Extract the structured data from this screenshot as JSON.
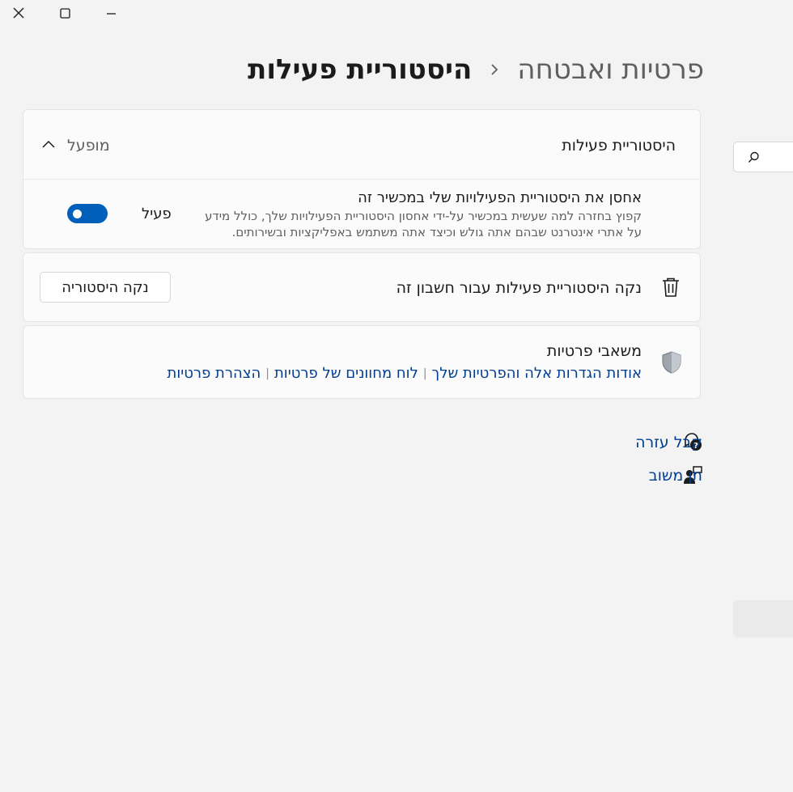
{
  "window": {
    "close_icon": "close-icon",
    "maximize_icon": "maximize-icon",
    "minimize_icon": "minimize-icon"
  },
  "breadcrumb": {
    "parent": "פרטיות ואבטחה",
    "separator_icon": "chevron-right-icon",
    "current": "היסטוריית פעילות"
  },
  "activity_history": {
    "title": "היסטוריית פעילות",
    "status": "מופעל",
    "expanded": true,
    "store_setting": {
      "title": "אחסן את היסטוריית הפעילויות שלי במכשיר זה",
      "description": "קפוץ בחזרה למה שעשית במכשיר על-ידי אחסון היסטוריית הפעילויות שלך, כולל מידע על אתרי אינטרנט שבהם אתה גולש וכיצד אתה משתמש באפליקציות ובשירותים.",
      "toggle_label": "פעיל",
      "toggle_on": true
    }
  },
  "clear_history": {
    "title": "נקה היסטוריית פעילות עבור חשבון זה",
    "button": "נקה היסטוריה",
    "icon": "trash-icon"
  },
  "privacy_resources": {
    "title": "משאבי פרטיות",
    "icon": "shield-icon",
    "links": [
      "אודות הגדרות אלה והפרטיות שלך",
      "לוח מחוונים של פרטיות",
      "הצהרת פרטיות"
    ]
  },
  "help": {
    "get_help": "קבל עזרה",
    "give_feedback": "תן משוב"
  },
  "colors": {
    "accent": "#005fb8",
    "link": "#003e92",
    "background": "#f3f3f3",
    "card": "#fbfbfb"
  }
}
